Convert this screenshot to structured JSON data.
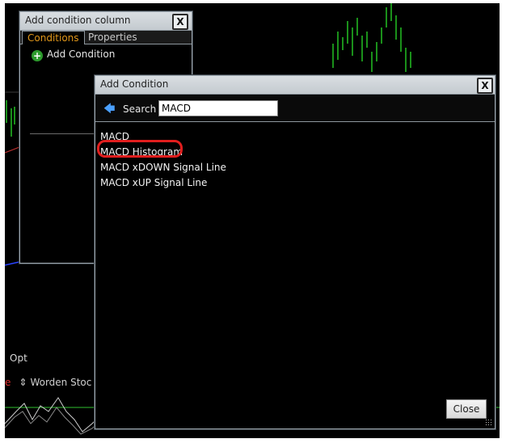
{
  "background": {
    "opt_label": "Opt",
    "indicator_label": "Worden Stoc",
    "indicator_prefix": "e"
  },
  "condition_column": {
    "title": "Add condition column",
    "close_label": "X",
    "tabs": [
      "Conditions",
      "Properties"
    ],
    "add_condition_label": "Add Condition"
  },
  "add_condition": {
    "title": "Add Condition",
    "close_label": "X",
    "search_label": "Search",
    "search_value": "MACD",
    "results": [
      "MACD",
      "MACD Histogram",
      "MACD xDOWN Signal Line",
      "MACD xUP Signal Line"
    ],
    "highlighted_index": 1,
    "close_button_label": "Close"
  },
  "colors": {
    "candle_green": "#22c022",
    "highlight_red": "#e01e1e",
    "tab_active": "#e0961a"
  }
}
